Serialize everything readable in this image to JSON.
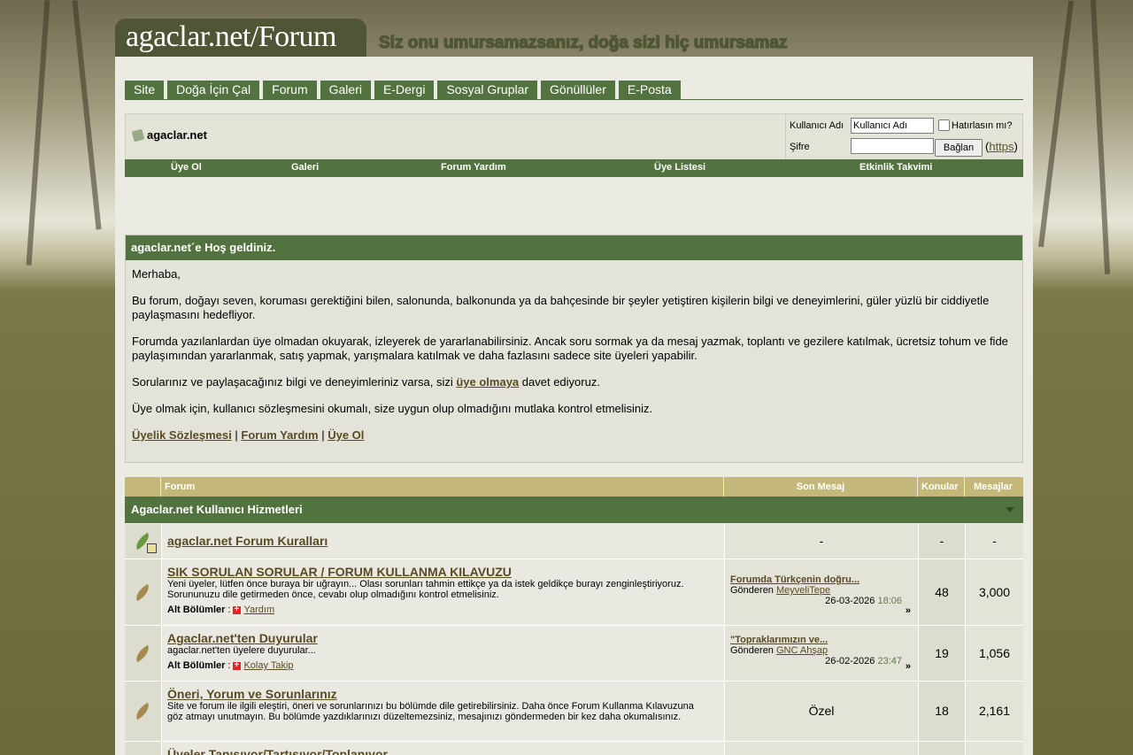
{
  "header": {
    "logo_text": "agaclar.net/Forum",
    "slogan": "Siz onu umursamazsanız, doğa sizi hiç umursamaz"
  },
  "topnav": [
    "Site",
    "Doğa İçin Çal",
    "Forum",
    "Galeri",
    "E-Dergi",
    "Sosyal Gruplar",
    "Gönüllüler",
    "E-Posta"
  ],
  "breadcrumb": {
    "label": "agaclar.net"
  },
  "login": {
    "username_label": "Kullanıcı Adı",
    "username_value": "Kullanıcı Adı",
    "password_label": "Şifre",
    "remember_label": "Hatırlasın mı?",
    "button_label": "Bağlan",
    "https_label": "https",
    "paren_open": "(",
    "paren_close": ")"
  },
  "subnav": [
    "Üye Ol",
    "Galeri",
    "Forum Yardım",
    "Üye Listesi",
    "Etkinlik Takvimi"
  ],
  "welcome": {
    "title": "agaclar.net´e Hoş geldiniz.",
    "greeting": "Merhaba,",
    "p1": "Bu forum, doğayı seven, koruması gerektiğini bilen, salonunda, balkonunda ya da bahçesinde bir şeyler yetiştiren kişilerin bilgi ve deneyimlerini, güler yüzlü bir ciddiyetle paylaşmasını hedefliyor.",
    "p2": "Forumda yazılanlardan üye olmadan okuyarak, izleyerek de yararlanabilirsiniz. Ancak soru sormak ya da mesaj yazmak, toplantı ve gezilere katılmak, ücretsiz tohum ve fide paylaşımından yararlanmak, satış yapmak, yarışmalara katılmak ve daha fazlasını sadece site üyeleri yapabilir.",
    "p3_before": "Sorularınız ve paylaşacağınız bilgi ve deneyimleriniz varsa, sizi ",
    "p3_link": "üye olmaya",
    "p3_after": " davet ediyoruz.",
    "p4": "Üye olmak için, kullanıcı sözleşmesini okumalı, size uygun olup olmadığını mutlaka kontrol etmelisiniz.",
    "links": [
      "Üyelik Sözleşmesi",
      "Forum Yardım",
      "Üye Ol"
    ],
    "sep": "|"
  },
  "forum_table": {
    "headers": {
      "forum": "Forum",
      "last_post": "Son Mesaj",
      "threads": "Konular",
      "posts": "Mesajlar"
    },
    "category": "Agaclar.net Kullanıcı Hizmetleri",
    "posted_by_label": "Gönderen",
    "sub_label": "Alt Bölümler",
    "rows": [
      {
        "title": "agaclar.net Forum Kuralları",
        "desc": "",
        "last_post": "-",
        "threads": "-",
        "posts": "-"
      },
      {
        "title": "SIK SORULAN SORULAR / FORUM KULLANMA KILAVUZU",
        "desc": "Yeni üyeler, lütfen önce buraya bir uğrayın... Olası sorunları tahmin ettikçe ya da istek geldikçe burayı zenginleştiriyoruz. Sorununuzu dile getirmeden önce, cevabı olup olmadığını kontrol etmelisiniz.",
        "sub": "Yardım",
        "lp_title": "Forumda Türkçenin doğru...",
        "lp_user": "MeyveliTepe",
        "lp_date": "26-03-2026",
        "lp_time": "18:06",
        "threads": "48",
        "posts": "3,000"
      },
      {
        "title": "Agaclar.net'ten Duyurular",
        "desc": "agaclar.net'ten üyelere duyurular...",
        "sub": "Kolay Takip",
        "lp_title": "\"Topraklarımızın ve...",
        "lp_user": "GNC Ahşap",
        "lp_date": "26-02-2026",
        "lp_time": "23:47",
        "threads": "19",
        "posts": "1,056"
      },
      {
        "title": "Öneri, Yorum ve Sorunlarınız",
        "desc": "Site ve forum ile ilgili eleştiri, öneri ve sorunlarınızı bu bölümde dile getirebilirsiniz. Daha önce Forum Kullanma Kılavuzuna göz atmayı unutmayın. Bu bölümde yazdıklarınızı düzeltemezsiniz, mesajınızı göndermeden bir kez daha okumalısınız.",
        "last_post": "Özel",
        "threads": "18",
        "posts": "2,161"
      },
      {
        "title": "Üyeler Tanışıyor/Tartışıyor/Toplanıyor"
      }
    ]
  }
}
